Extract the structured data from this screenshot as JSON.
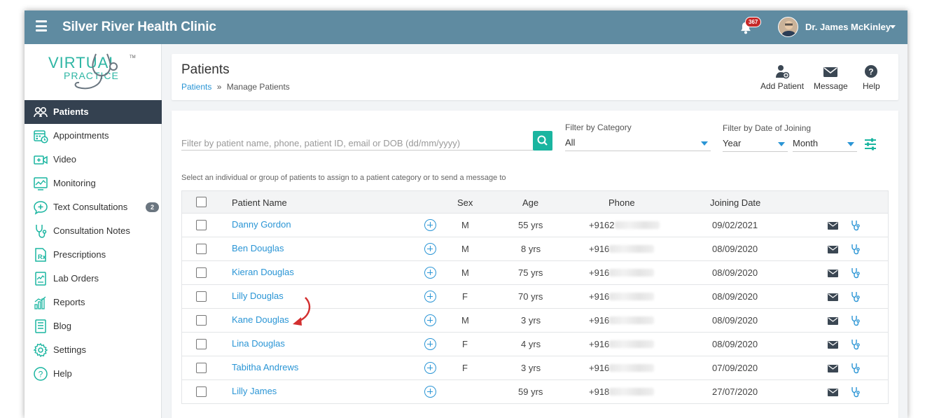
{
  "header": {
    "app_title": "Silver River Health Clinic",
    "notification_count": "367",
    "user_name": "Dr. James McKinley"
  },
  "logo": {
    "line1": "VIRTUAL",
    "line2": "PRACTICE",
    "tm": "TM"
  },
  "sidebar": {
    "items": [
      {
        "label": "Patients",
        "icon": "patients-icon",
        "active": true
      },
      {
        "label": "Appointments",
        "icon": "calendar-icon"
      },
      {
        "label": "Video",
        "icon": "video-icon"
      },
      {
        "label": "Monitoring",
        "icon": "monitor-chart-icon"
      },
      {
        "label": "Text Consultations",
        "icon": "chat-plus-icon",
        "count": "2"
      },
      {
        "label": "Consultation Notes",
        "icon": "stethoscope-icon"
      },
      {
        "label": "Prescriptions",
        "icon": "rx-icon"
      },
      {
        "label": "Lab Orders",
        "icon": "lab-report-icon"
      },
      {
        "label": "Reports",
        "icon": "bar-chart-icon"
      },
      {
        "label": "Blog",
        "icon": "blog-icon"
      },
      {
        "label": "Settings",
        "icon": "gear-icon"
      },
      {
        "label": "Help",
        "icon": "help-circle-icon"
      }
    ]
  },
  "page": {
    "title": "Patients",
    "breadcrumb_link": "Patients",
    "breadcrumb_sep": "»",
    "breadcrumb_current": "Manage Patients",
    "actions": {
      "add_patient": "Add Patient",
      "message": "Message",
      "help": "Help"
    }
  },
  "filters": {
    "search_placeholder": "Filter by patient name, phone, patient ID, email or DOB (dd/mm/yyyy)",
    "category_label": "Filter by Category",
    "category_value": "All",
    "date_label": "Filter by Date of Joining",
    "year_value": "Year",
    "month_value": "Month",
    "helper_text": "Select an individual or group of patients to assign to a patient category or to send a message to"
  },
  "table": {
    "headers": {
      "name": "Patient Name",
      "sex": "Sex",
      "age": "Age",
      "phone": "Phone",
      "joining": "Joining Date"
    },
    "rows": [
      {
        "name": "Danny Gordon",
        "sex": "M",
        "age": "55 yrs",
        "phone": "+9162",
        "date": "09/02/2021"
      },
      {
        "name": "Ben Douglas",
        "sex": "M",
        "age": "8 yrs",
        "phone": "+916",
        "date": "08/09/2020"
      },
      {
        "name": "Kieran Douglas",
        "sex": "M",
        "age": "75 yrs",
        "phone": "+916",
        "date": "08/09/2020"
      },
      {
        "name": "Lilly Douglas",
        "sex": "F",
        "age": "70 yrs",
        "phone": "+916",
        "date": "08/09/2020"
      },
      {
        "name": "Kane Douglas",
        "sex": "M",
        "age": "3 yrs",
        "phone": "+916",
        "date": "08/09/2020"
      },
      {
        "name": "Lina Douglas",
        "sex": "F",
        "age": "4 yrs",
        "phone": "+916",
        "date": "08/09/2020"
      },
      {
        "name": "Tabitha Andrews",
        "sex": "F",
        "age": "3 yrs",
        "phone": "+916",
        "date": "07/09/2020"
      },
      {
        "name": "Lilly James",
        "sex": "",
        "age": "59 yrs",
        "phone": "+918",
        "date": "27/07/2020"
      }
    ]
  },
  "colors": {
    "topbar": "#5f8ba1",
    "sidebar_active": "#344150",
    "link": "#2a95d5",
    "search_button": "#1ab5a0",
    "badge": "#c62828",
    "annotation_arrow": "#d32f2f"
  }
}
